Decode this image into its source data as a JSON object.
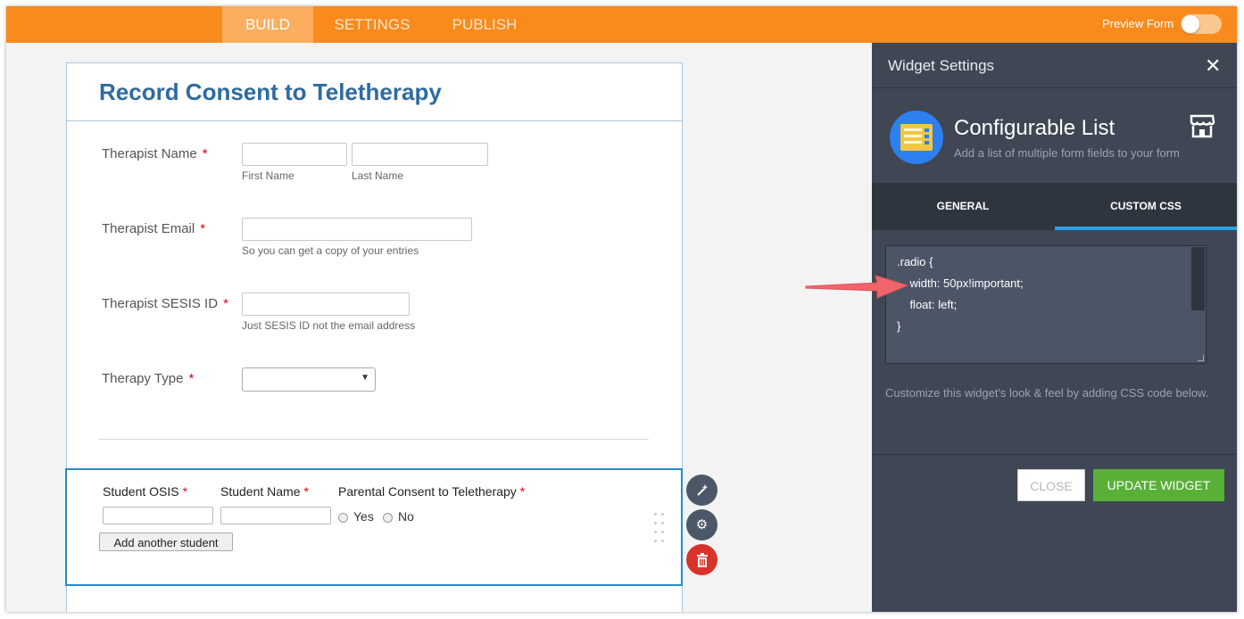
{
  "nav": {
    "tabs": [
      {
        "label": "BUILD",
        "active": true
      },
      {
        "label": "SETTINGS",
        "active": false
      },
      {
        "label": "PUBLISH",
        "active": false
      }
    ],
    "preview_label": "Preview Form",
    "preview_enabled": false
  },
  "form": {
    "title": "Record Consent to Teletherapy",
    "fields": {
      "therapist_name": {
        "label": "Therapist Name",
        "required": "*",
        "first_sub": "First Name",
        "last_sub": "Last Name"
      },
      "therapist_email": {
        "label": "Therapist Email",
        "required": "*",
        "sub": "So you can get a copy of your entries"
      },
      "therapist_sesis": {
        "label": "Therapist SESIS ID",
        "required": "*",
        "sub": "Just SESIS ID not the email address"
      },
      "therapy_type": {
        "label": "Therapy Type",
        "required": "*",
        "selected": ""
      }
    },
    "widget": {
      "col1": "Student OSIS",
      "col2": "Student Name",
      "col3": "Parental Consent to Teletherapy",
      "required": "*",
      "radio_yes": "Yes",
      "radio_no": "No",
      "add_button": "Add another student"
    },
    "tools": {
      "wand_icon": "magic-wand-icon",
      "gear_icon": "gear-icon",
      "trash_icon": "trash-icon"
    }
  },
  "panel": {
    "title": "Widget Settings",
    "close_icon": "close-icon",
    "widget_name": "Configurable List",
    "widget_desc": "Add a list of multiple form fields to your form",
    "store_icon": "store-icon",
    "tabs": {
      "general": "GENERAL",
      "custom_css": "CUSTOM CSS",
      "active": "CUSTOM CSS"
    },
    "css_lines": [
      ".radio {",
      "    width: 50px!important;",
      "    float: left;",
      "}"
    ],
    "help": "Customize this widget's look & feel by adding CSS code below.",
    "close_button": "CLOSE",
    "update_button": "UPDATE WIDGET"
  },
  "colors": {
    "nav_orange": "#f98a1c",
    "title_blue": "#2e6ba0",
    "panel_bg": "#3f4754",
    "accent_blue": "#2a9fe0",
    "update_green": "#58b036",
    "delete_red": "#d7332b",
    "annotation_arrow": "#f0656b"
  }
}
